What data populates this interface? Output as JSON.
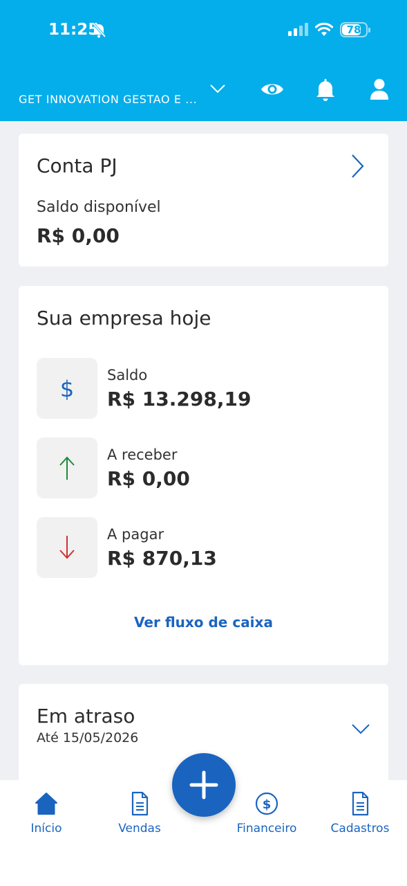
{
  "status_bar": {
    "time": "11:25",
    "battery": "78",
    "battery_level": 0.78
  },
  "header": {
    "company": "GET INNOVATION GESTAO E ..."
  },
  "conta_pj": {
    "title": "Conta PJ",
    "saldo_label": "Saldo disponível",
    "saldo_value": "R$ 0,00"
  },
  "empresa_hoje": {
    "title": "Sua empresa hoje",
    "rows": [
      {
        "label": "Saldo",
        "value": "R$ 13.298,19",
        "icon": "dollar-icon",
        "color": "#1a64c0"
      },
      {
        "label": "A receber",
        "value": "R$ 0,00",
        "icon": "arrow-up-icon",
        "color": "#1d8a3a"
      },
      {
        "label": "A pagar",
        "value": "R$ 870,13",
        "icon": "arrow-down-icon",
        "color": "#d32f2f"
      }
    ],
    "link": "Ver fluxo de caixa"
  },
  "em_atraso": {
    "title": "Em atraso",
    "subtitle": "Até 15/05/2026"
  },
  "nav": [
    {
      "label": "Início",
      "icon": "home-icon"
    },
    {
      "label": "Vendas",
      "icon": "document-icon"
    },
    {
      "label": "Financeiro",
      "icon": "dollar-circle-icon"
    },
    {
      "label": "Cadastros",
      "icon": "document-icon"
    }
  ],
  "colors": {
    "header": "#04aeea",
    "accent": "#1a64c0",
    "background": "#eff0f4"
  }
}
